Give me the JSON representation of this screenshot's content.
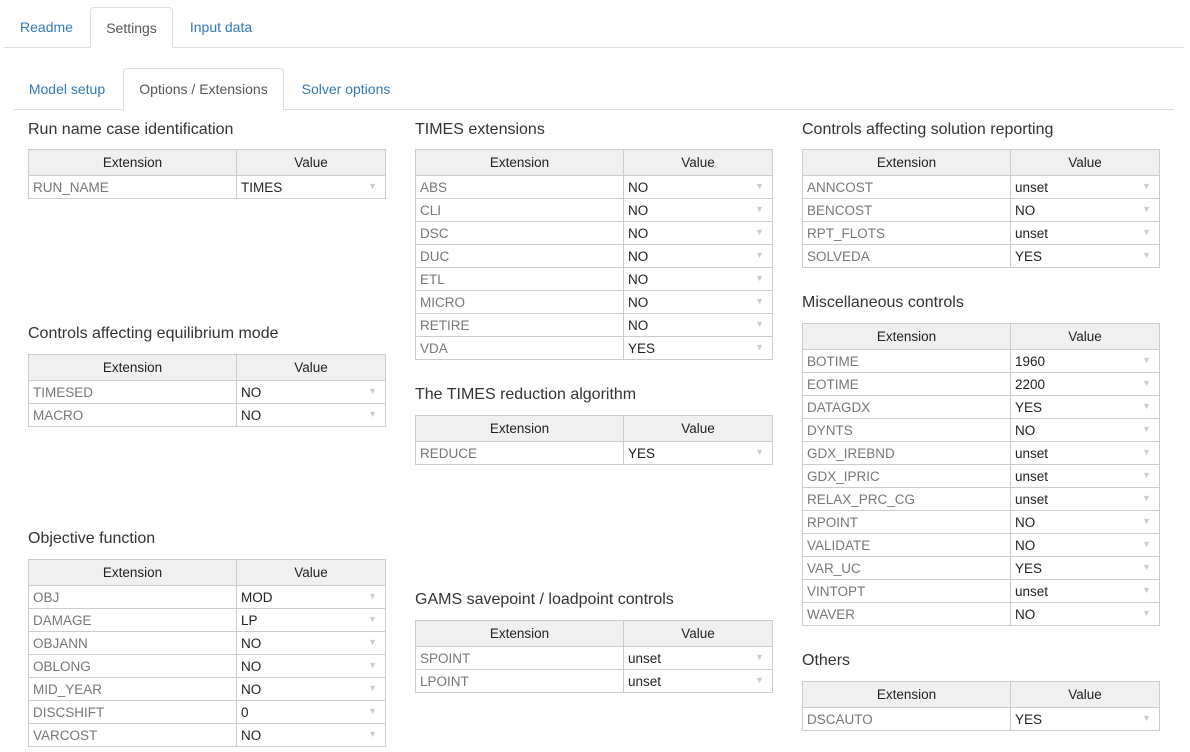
{
  "top_tabs": [
    {
      "label": "Readme",
      "active": false
    },
    {
      "label": "Settings",
      "active": true
    },
    {
      "label": "Input data",
      "active": false
    }
  ],
  "sub_tabs": [
    {
      "label": "Model setup",
      "active": false
    },
    {
      "label": "Options / Extensions",
      "active": true
    },
    {
      "label": "Solver options",
      "active": false
    }
  ],
  "col_extension": "Extension",
  "col_value": "Value",
  "sections": {
    "run_name": {
      "title": "Run name case identification",
      "rows": [
        [
          "RUN_NAME",
          "TIMES"
        ]
      ]
    },
    "equilibrium": {
      "title": "Controls affecting equilibrium mode",
      "rows": [
        [
          "TIMESED",
          "NO"
        ],
        [
          "MACRO",
          "NO"
        ]
      ]
    },
    "objective": {
      "title": "Objective function",
      "rows": [
        [
          "OBJ",
          "MOD"
        ],
        [
          "DAMAGE",
          "LP"
        ],
        [
          "OBJANN",
          "NO"
        ],
        [
          "OBLONG",
          "NO"
        ],
        [
          "MID_YEAR",
          "NO"
        ],
        [
          "DISCSHIFT",
          "0"
        ],
        [
          "VARCOST",
          "NO"
        ]
      ]
    },
    "times_ext": {
      "title": "TIMES extensions",
      "rows": [
        [
          "ABS",
          "NO"
        ],
        [
          "CLI",
          "NO"
        ],
        [
          "DSC",
          "NO"
        ],
        [
          "DUC",
          "NO"
        ],
        [
          "ETL",
          "NO"
        ],
        [
          "MICRO",
          "NO"
        ],
        [
          "RETIRE",
          "NO"
        ],
        [
          "VDA",
          "YES"
        ]
      ]
    },
    "reduction": {
      "title": "The TIMES reduction algorithm",
      "rows": [
        [
          "REDUCE",
          "YES"
        ]
      ]
    },
    "gams": {
      "title": "GAMS savepoint / loadpoint controls",
      "rows": [
        [
          "SPOINT",
          "unset"
        ],
        [
          "LPOINT",
          "unset"
        ]
      ]
    },
    "reporting": {
      "title": "Controls affecting solution reporting",
      "rows": [
        [
          "ANNCOST",
          "unset"
        ],
        [
          "BENCOST",
          "NO"
        ],
        [
          "RPT_FLOTS",
          "unset"
        ],
        [
          "SOLVEDA",
          "YES"
        ]
      ]
    },
    "misc": {
      "title": "Miscellaneous controls",
      "rows": [
        [
          "BOTIME",
          "1960"
        ],
        [
          "EOTIME",
          "2200"
        ],
        [
          "DATAGDX",
          "YES"
        ],
        [
          "DYNTS",
          "NO"
        ],
        [
          "GDX_IREBND",
          "unset"
        ],
        [
          "GDX_IPRIC",
          "unset"
        ],
        [
          "RELAX_PRC_CG",
          "unset"
        ],
        [
          "RPOINT",
          "NO"
        ],
        [
          "VALIDATE",
          "NO"
        ],
        [
          "VAR_UC",
          "YES"
        ],
        [
          "VINTOPT",
          "unset"
        ],
        [
          "WAVER",
          "NO"
        ]
      ]
    },
    "others": {
      "title": "Others",
      "rows": [
        [
          "DSCAUTO",
          "YES"
        ]
      ]
    }
  },
  "icons": {
    "dropdown": "▼"
  }
}
